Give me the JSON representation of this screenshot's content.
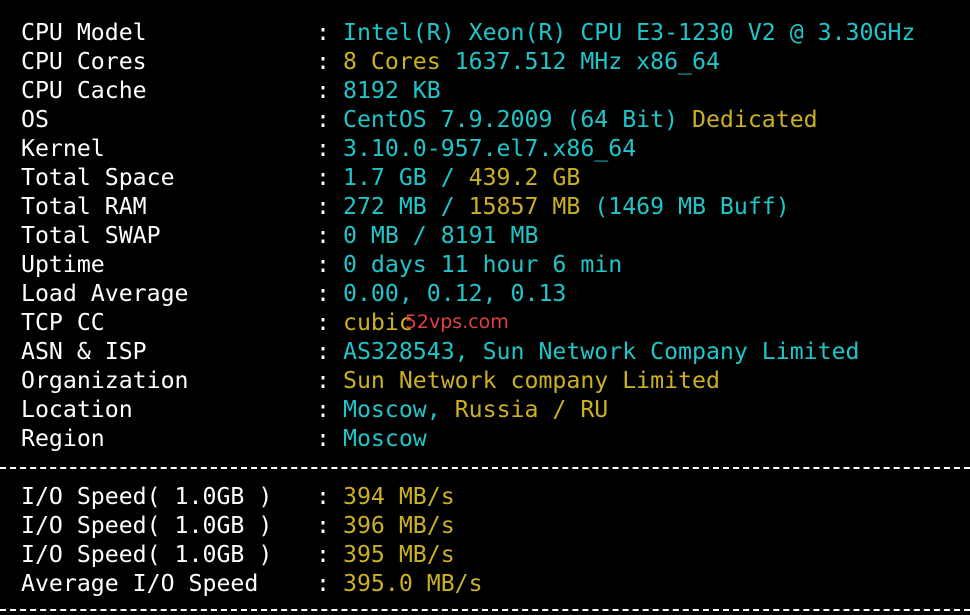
{
  "system_info": [
    {
      "label": "CPU Model",
      "parts": [
        {
          "text": "Intel(R) Xeon(R) CPU E3-1230 V2 @ 3.30GHz",
          "color": "cyan"
        }
      ]
    },
    {
      "label": "CPU Cores",
      "parts": [
        {
          "text": "8 Cores",
          "color": "yellow"
        },
        {
          "text": " 1637.512 MHz x86_64",
          "color": "cyan"
        }
      ]
    },
    {
      "label": "CPU Cache",
      "parts": [
        {
          "text": "8192 KB",
          "color": "cyan"
        }
      ]
    },
    {
      "label": "OS",
      "parts": [
        {
          "text": "CentOS 7.9.2009 (64 Bit)",
          "color": "cyan"
        },
        {
          "text": " Dedicated",
          "color": "yellow"
        }
      ]
    },
    {
      "label": "Kernel",
      "parts": [
        {
          "text": "3.10.0-957.el7.x86_64",
          "color": "cyan"
        }
      ]
    },
    {
      "label": "Total Space",
      "parts": [
        {
          "text": "1.7 GB / ",
          "color": "cyan"
        },
        {
          "text": "439.2 GB",
          "color": "yellow"
        }
      ]
    },
    {
      "label": "Total RAM",
      "parts": [
        {
          "text": "272 MB / ",
          "color": "cyan"
        },
        {
          "text": "15857 MB",
          "color": "yellow"
        },
        {
          "text": " (1469 MB Buff)",
          "color": "cyan"
        }
      ]
    },
    {
      "label": "Total SWAP",
      "parts": [
        {
          "text": "0 MB / 8191 MB",
          "color": "cyan"
        }
      ]
    },
    {
      "label": "Uptime",
      "parts": [
        {
          "text": "0 days 11 hour 6 min",
          "color": "cyan"
        }
      ]
    },
    {
      "label": "Load Average",
      "parts": [
        {
          "text": "0.00, 0.12, 0.13",
          "color": "cyan"
        }
      ]
    },
    {
      "label": "TCP CC",
      "parts": [
        {
          "text": "cubic",
          "color": "yellow"
        }
      ],
      "watermark": "52vps.com"
    },
    {
      "label": "ASN & ISP",
      "parts": [
        {
          "text": "AS328543, Sun Network Company Limited",
          "color": "cyan"
        }
      ]
    },
    {
      "label": "Organization",
      "parts": [
        {
          "text": "Sun Network company Limited",
          "color": "yellow"
        }
      ]
    },
    {
      "label": "Location",
      "parts": [
        {
          "text": "Moscow, ",
          "color": "cyan"
        },
        {
          "text": "Russia / RU",
          "color": "yellow"
        }
      ]
    },
    {
      "label": "Region",
      "parts": [
        {
          "text": "Moscow",
          "color": "cyan"
        }
      ]
    }
  ],
  "io_info": [
    {
      "label": "I/O Speed( 1.0GB )",
      "parts": [
        {
          "text": "394 MB/s",
          "color": "yellow"
        }
      ]
    },
    {
      "label": "I/O Speed( 1.0GB )",
      "parts": [
        {
          "text": "396 MB/s",
          "color": "yellow"
        }
      ]
    },
    {
      "label": "I/O Speed( 1.0GB )",
      "parts": [
        {
          "text": "395 MB/s",
          "color": "yellow"
        }
      ]
    },
    {
      "label": "Average I/O Speed",
      "parts": [
        {
          "text": "395.0 MB/s",
          "color": "yellow"
        }
      ]
    }
  ],
  "separator": ":",
  "colors": {
    "background": "#000000",
    "label": "#ffffff",
    "cyan": "#1fc5c9",
    "yellow": "#cbb021",
    "watermark": "#e04040"
  }
}
